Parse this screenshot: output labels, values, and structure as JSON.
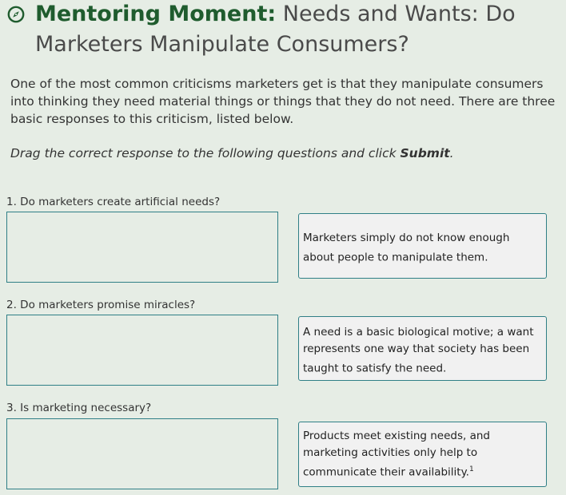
{
  "header": {
    "strong": "Mentoring Moment:",
    "title_line1": "Needs and Wants: Do",
    "title_line2": "Marketers Manipulate Consumers?"
  },
  "intro": "One of the most common criticisms marketers get is that they manipulate consumers into thinking they need material things or things that they do not need. There are three basic responses to this criticism, listed below.",
  "instruction": {
    "text": "Drag the correct response to the following questions and click ",
    "emphasis": "Submit",
    "end": "."
  },
  "questions": [
    {
      "label": "1. Do marketers create artificial needs?"
    },
    {
      "label": "2. Do marketers promise miracles?"
    },
    {
      "label": "3. Is marketing necessary?"
    }
  ],
  "responses": [
    {
      "text": "Marketers simply do not know enough about people to manipulate them.",
      "sup": ""
    },
    {
      "text": "A need is a basic biological motive; a want represents one way that society has been taught to satisfy the need.",
      "sup": ""
    },
    {
      "text": "Products meet existing needs, and marketing activities only help to communicate their availability.",
      "sup": "1"
    }
  ],
  "colors": {
    "background": "#e6ede5",
    "accent_green": "#1f5c2e",
    "border_teal": "#2f7f86",
    "card_bg": "#f1f1f1"
  },
  "icons": {
    "title_icon": "compass-icon"
  }
}
